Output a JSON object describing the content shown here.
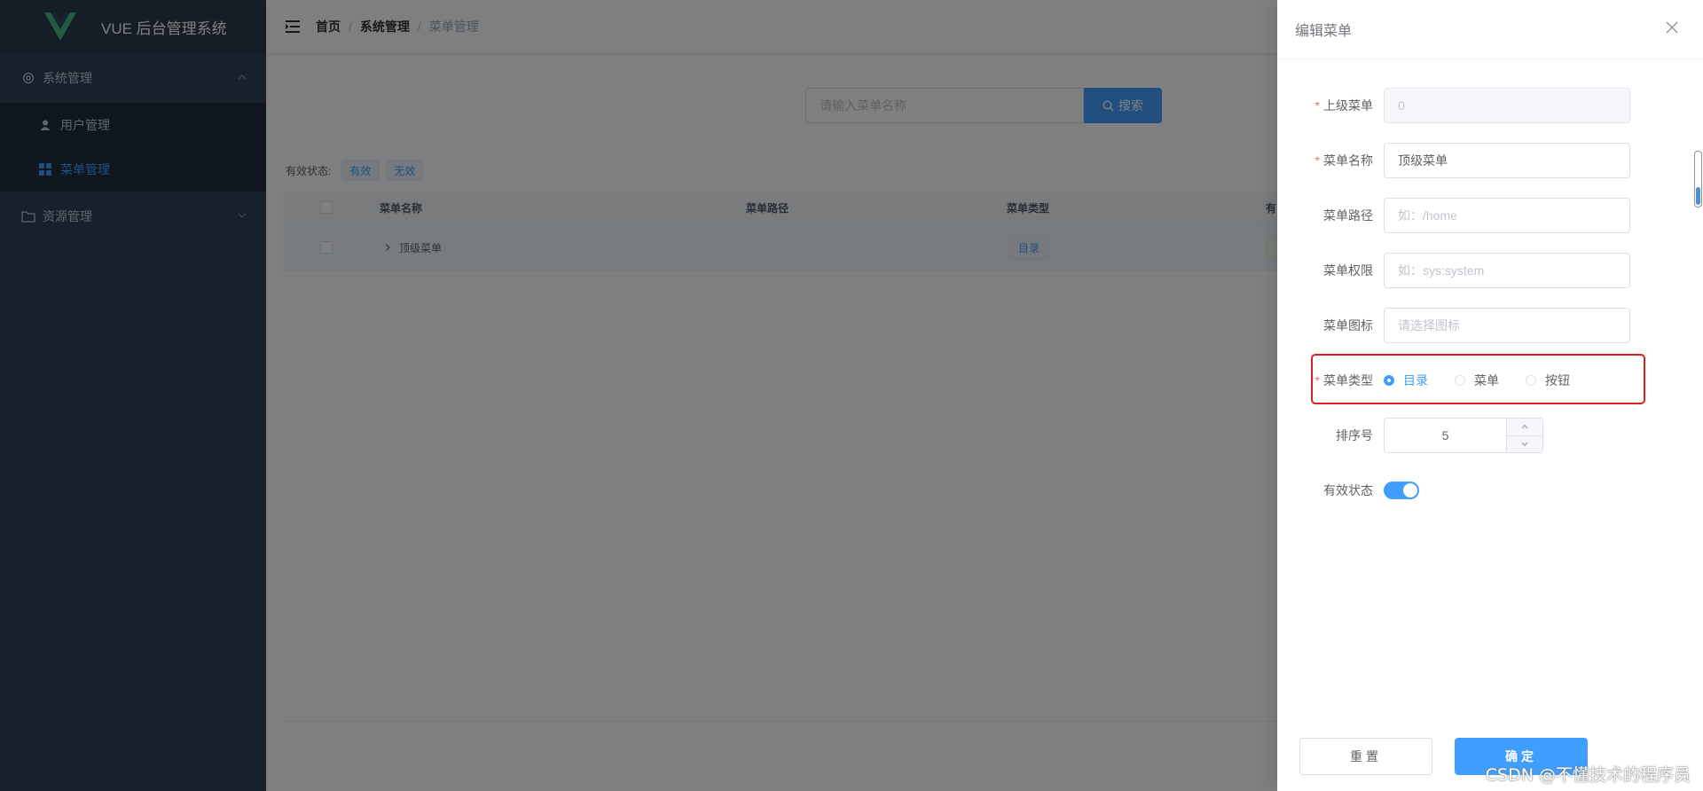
{
  "app": {
    "title": "VUE 后台管理系统",
    "accent": "#409eff",
    "sidebar_bg": "#304156"
  },
  "sidebar": {
    "groups": [
      {
        "label": "系统管理",
        "icon": "gear-icon",
        "expanded": true,
        "items": [
          {
            "label": "用户管理",
            "icon": "user-icon",
            "active": false
          },
          {
            "label": "菜单管理",
            "icon": "grid-icon",
            "active": true
          }
        ]
      },
      {
        "label": "资源管理",
        "icon": "folder-icon",
        "expanded": false,
        "items": []
      }
    ]
  },
  "breadcrumb": [
    "首页",
    "系统管理",
    "菜单管理"
  ],
  "search": {
    "placeholder": "请输入菜单名称",
    "button_label": "搜索"
  },
  "filter": {
    "label": "有效状态:",
    "tags": [
      "有效",
      "无效"
    ]
  },
  "table": {
    "columns": [
      "菜单名称",
      "菜单路径",
      "菜单类型",
      "有"
    ],
    "rows": [
      {
        "name": "顶级菜单",
        "path": "",
        "type": "目录"
      }
    ]
  },
  "drawer": {
    "title": "编辑菜单",
    "fields": {
      "parent": {
        "label": "上级菜单",
        "value": "0",
        "required": true
      },
      "name": {
        "label": "菜单名称",
        "value": "顶级菜单",
        "required": true
      },
      "path": {
        "label": "菜单路径",
        "placeholder": "如：/home"
      },
      "perm": {
        "label": "菜单权限",
        "placeholder": "如：sys:system"
      },
      "icon": {
        "label": "菜单图标",
        "placeholder": "请选择图标"
      },
      "type": {
        "label": "菜单类型",
        "required": true,
        "options": [
          "目录",
          "菜单",
          "按钮"
        ],
        "selected": "目录"
      },
      "sort": {
        "label": "排序号",
        "value": "5"
      },
      "status": {
        "label": "有效状态",
        "on": true
      }
    },
    "reset_label": "重置",
    "confirm_label": "确定"
  },
  "watermark": "CSDN @不懂技术的程序员"
}
